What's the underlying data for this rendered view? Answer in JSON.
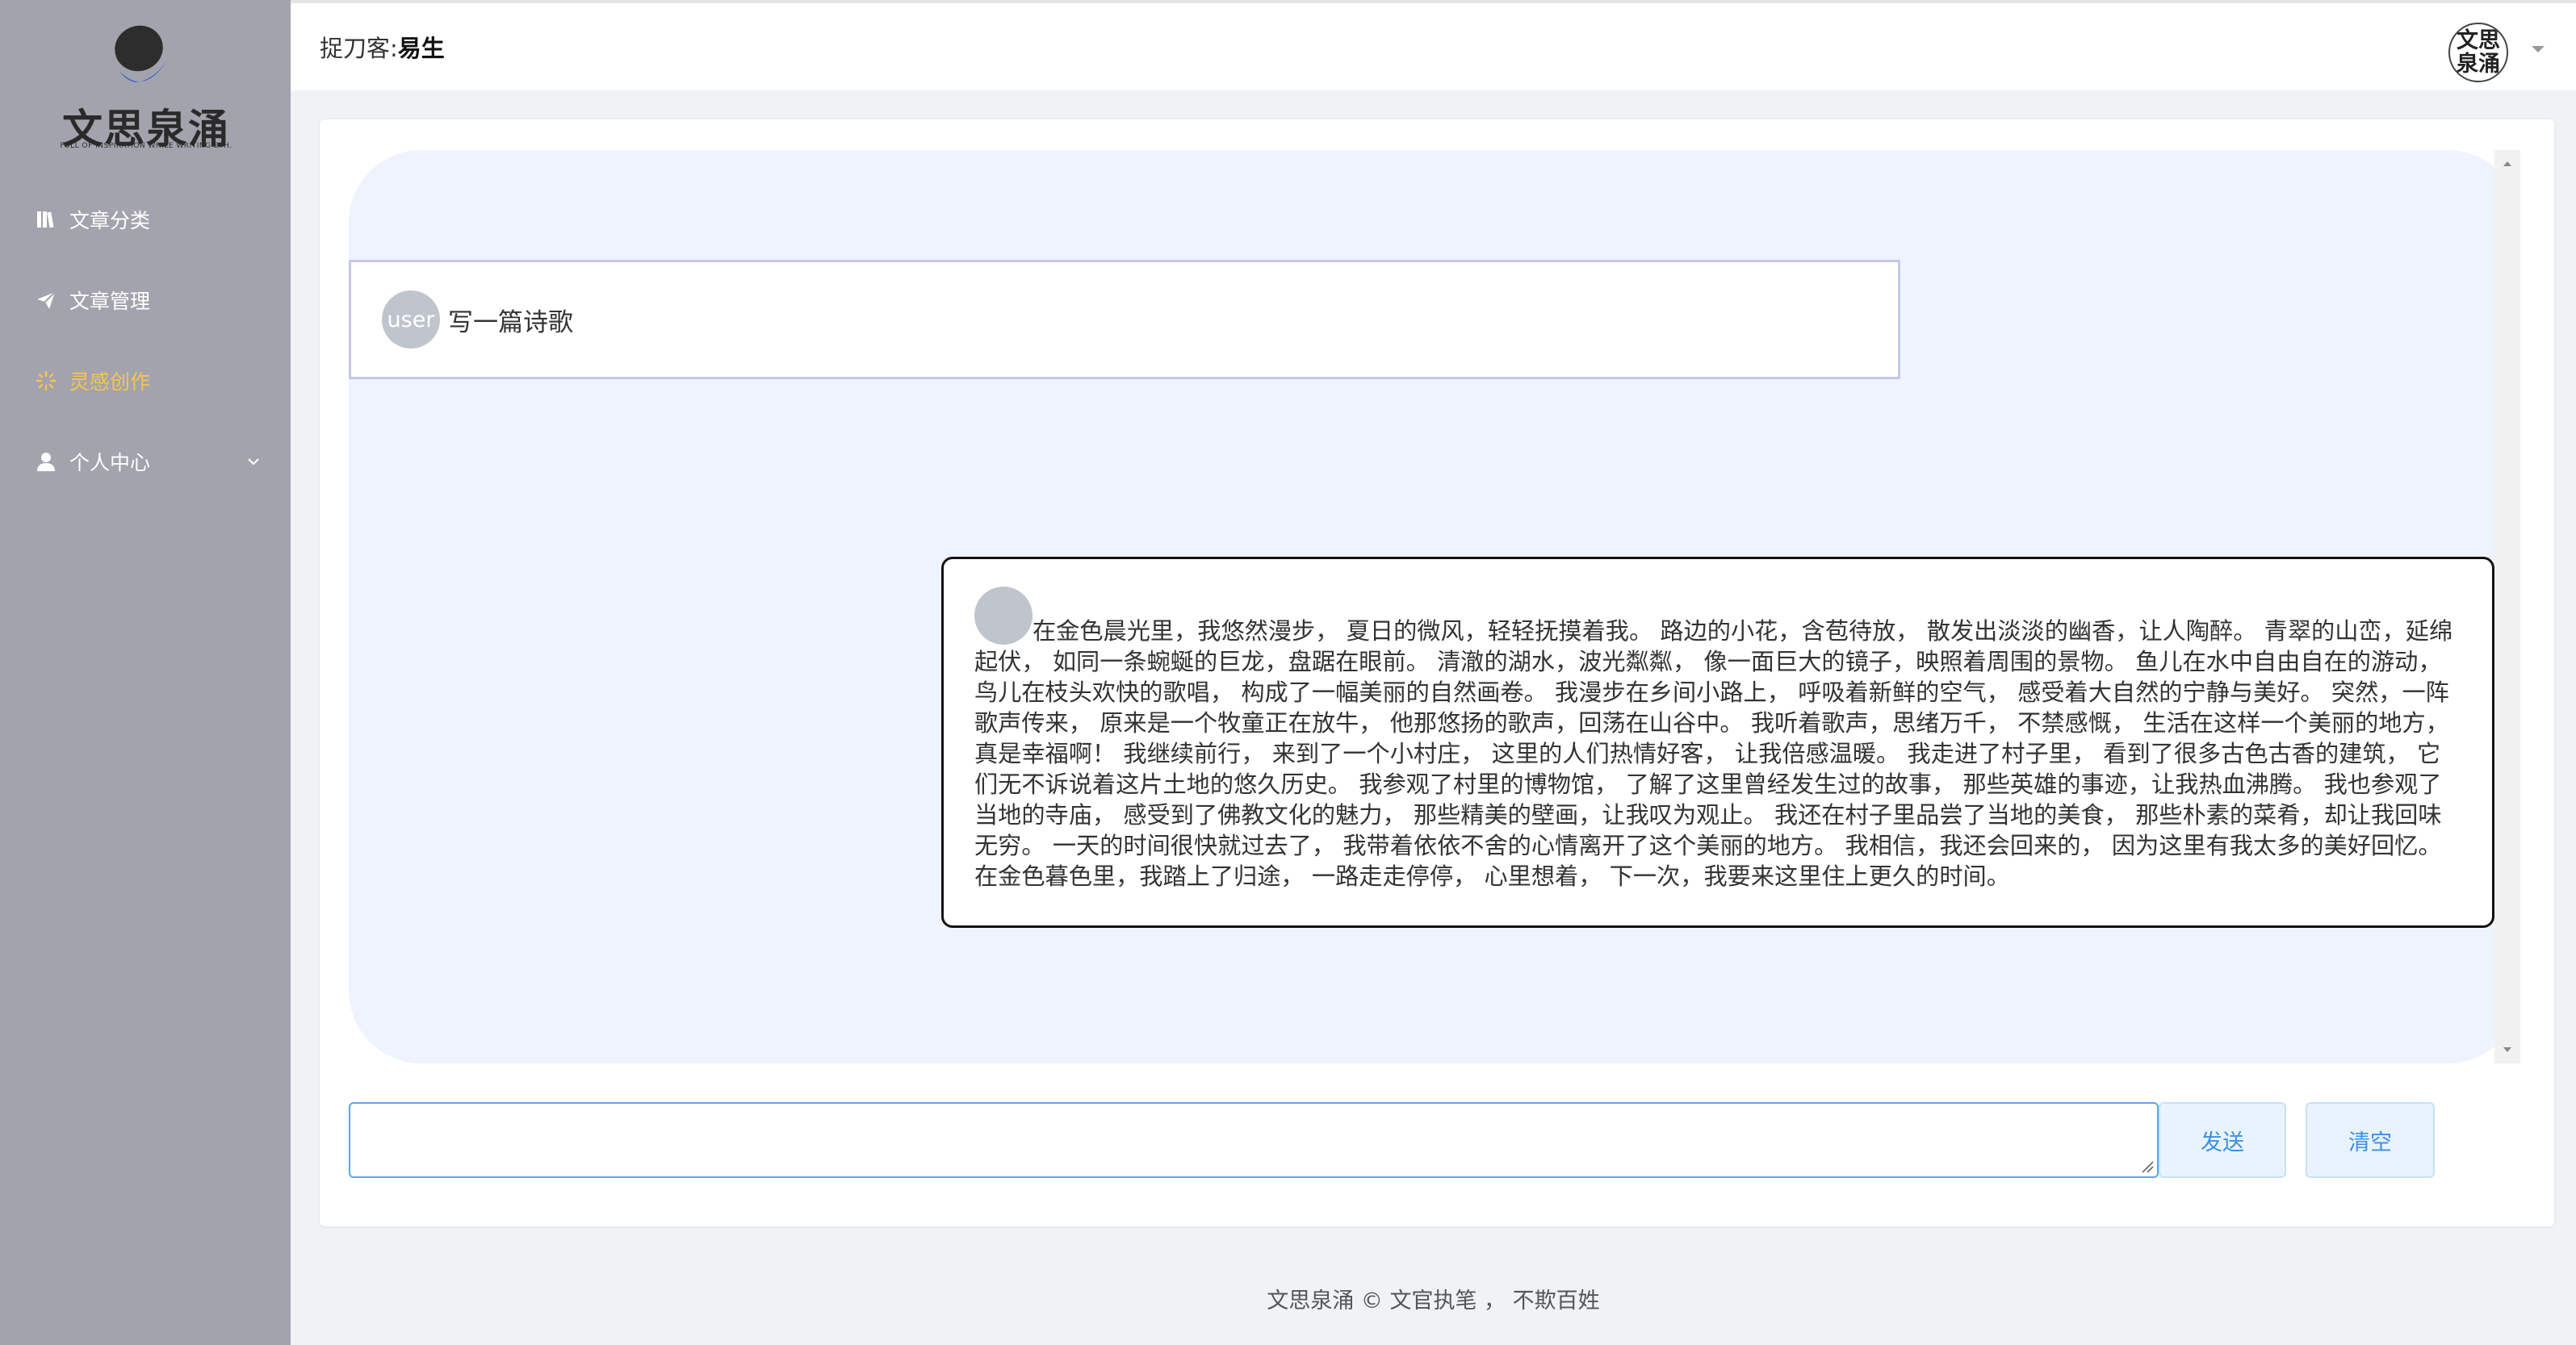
{
  "sidebar": {
    "logo": {
      "title": "文思泉涌",
      "subtitle": "FULL OF INSPIRATION WHILE WRITING STH."
    },
    "items": [
      {
        "label": "文章分类",
        "icon": "book-icon"
      },
      {
        "label": "文章管理",
        "icon": "paper-plane-icon"
      },
      {
        "label": "灵感创作",
        "icon": "sparkle-icon",
        "active": true
      },
      {
        "label": "个人中心",
        "icon": "user-icon",
        "expandable": true
      }
    ],
    "active_color": "#f5c451",
    "background": "#a3a3ad"
  },
  "header": {
    "label": "捉刀客:",
    "username": "易生",
    "avatar_text": "文思泉涌"
  },
  "chat": {
    "messages": [
      {
        "role": "user",
        "avatar_text": "user",
        "text": "写一篇诗歌"
      },
      {
        "role": "assistant",
        "avatar_text": "",
        "text": "在金色晨光里，我悠然漫步， 夏日的微风，轻轻抚摸着我。 路边的小花，含苞待放， 散发出淡淡的幽香，让人陶醉。 青翠的山峦，延绵起伏， 如同一条蜿蜒的巨龙，盘踞在眼前。 清澈的湖水，波光粼粼， 像一面巨大的镜子，映照着周围的景物。 鱼儿在水中自由自在的游动， 鸟儿在枝头欢快的歌唱， 构成了一幅美丽的自然画卷。 我漫步在乡间小路上， 呼吸着新鲜的空气， 感受着大自然的宁静与美好。 突然，一阵歌声传来， 原来是一个牧童正在放牛， 他那悠扬的歌声，回荡在山谷中。 我听着歌声，思绪万千， 不禁感慨， 生活在这样一个美丽的地方， 真是幸福啊！ 我继续前行， 来到了一个小村庄， 这里的人们热情好客， 让我倍感温暖。 我走进了村子里， 看到了很多古色古香的建筑， 它们无不诉说着这片土地的悠久历史。 我参观了村里的博物馆， 了解了这里曾经发生过的故事， 那些英雄的事迹，让我热血沸腾。 我也参观了当地的寺庙， 感受到了佛教文化的魅力， 那些精美的壁画，让我叹为观止。 我还在村子里品尝了当地的美食， 那些朴素的菜肴，却让我回味无穷。 一天的时间很快就过去了， 我带着依依不舍的心情离开了这个美丽的地方。 我相信，我还会回来的， 因为这里有我太多的美好回忆。 在金色暮色里，我踏上了归途， 一路走走停停， 心里想着， 下一次，我要来这里住上更久的时间。"
      }
    ]
  },
  "input": {
    "value": "",
    "placeholder": ""
  },
  "buttons": {
    "send": "发送",
    "clear": "清空"
  },
  "footer": {
    "text": "文思泉涌 © 文官执笔 ， 不欺百姓"
  }
}
